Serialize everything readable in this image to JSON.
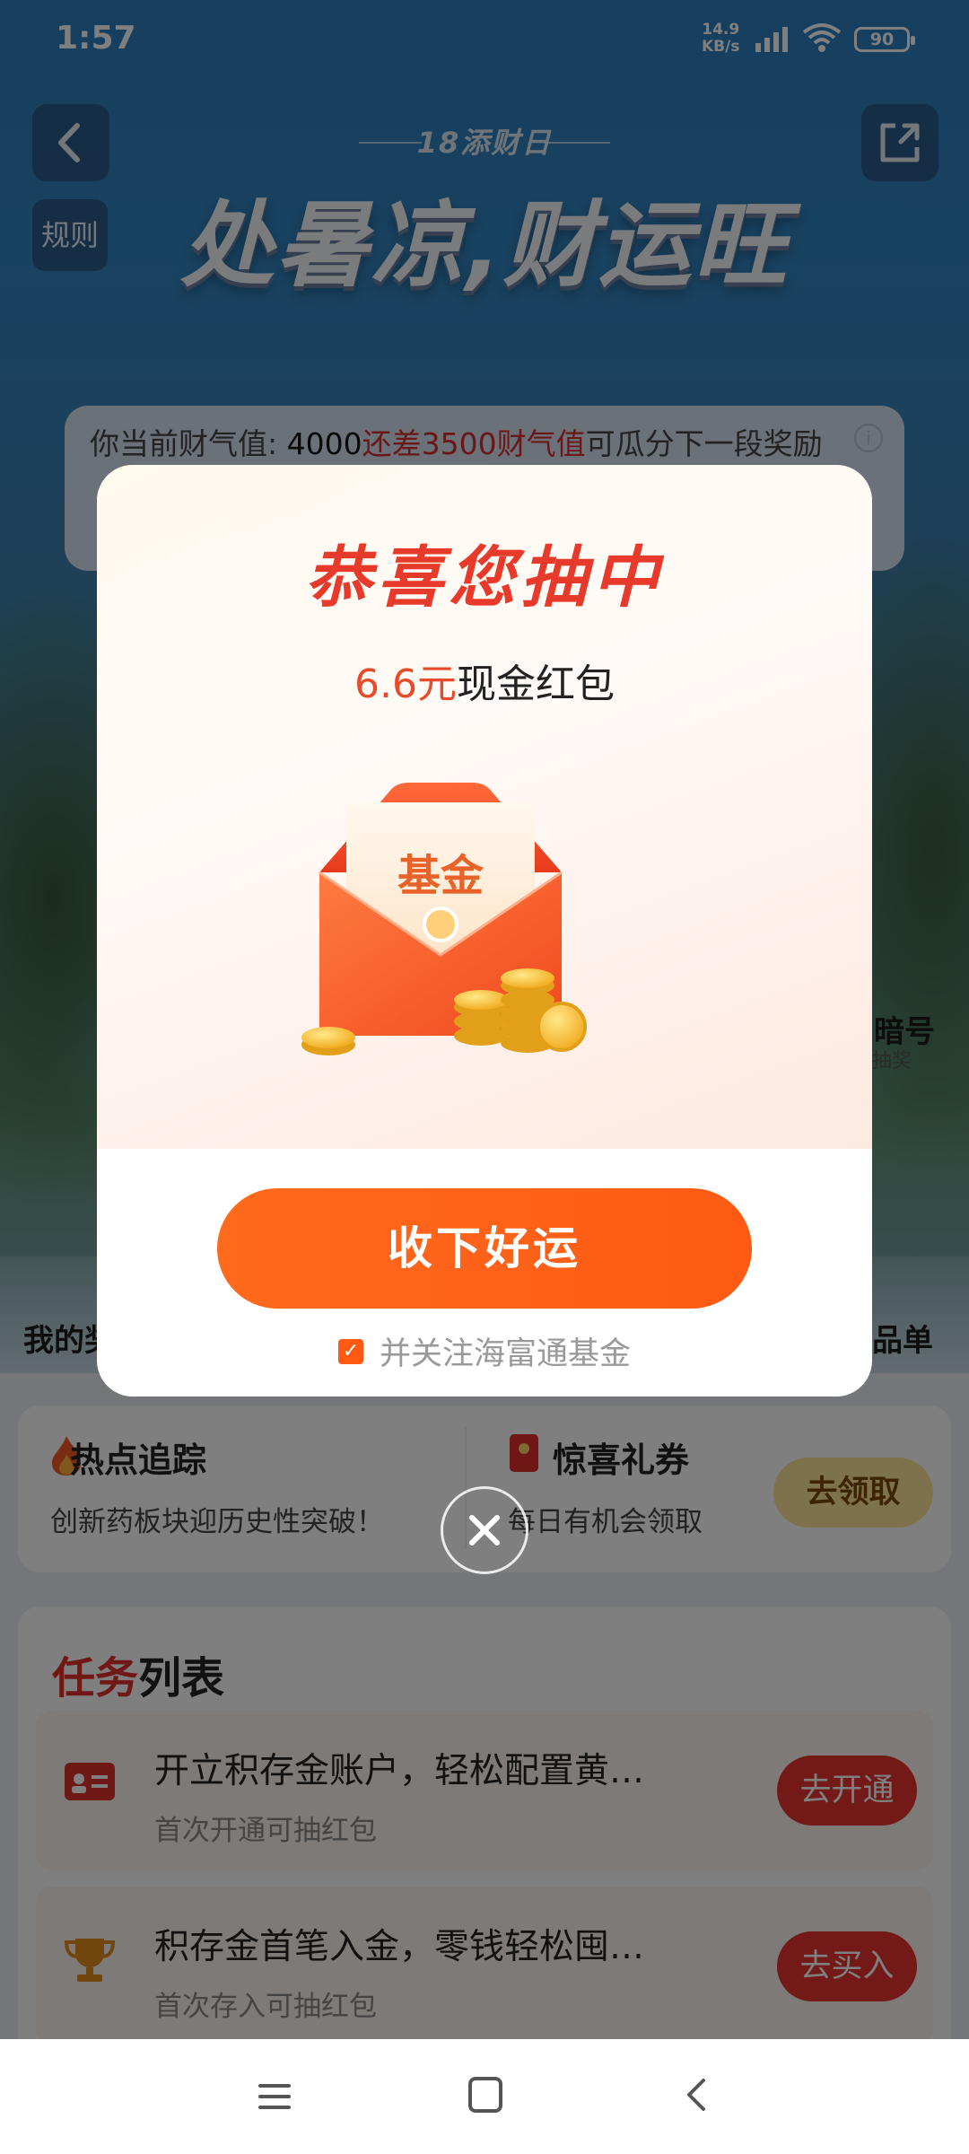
{
  "status_bar": {
    "time": "1:57",
    "net_speed_value": "14.9",
    "net_speed_unit": "KB/s",
    "battery": "90"
  },
  "page": {
    "rule_label": "规则",
    "banner_subtitle": "18添财日",
    "banner_title": "处暑凉,财运旺",
    "wealth": {
      "prefix": "你当前财气值: ",
      "current": "4000",
      "gap_text": "还差3500财气值",
      "suffix": "可瓜分下一段奖励"
    },
    "side_left_label": "我的奖",
    "side_right_label": "暗号",
    "side_right_small": "抽奖",
    "side_right_label2": "品单",
    "hot": {
      "left_title": "热点追踪",
      "left_desc": "创新药板块迎历史性突破！",
      "right_title": "惊喜礼券",
      "right_desc": "每日有机会领取",
      "claim_button": "去领取"
    },
    "tasks": {
      "title_red": "任务",
      "title_rest": "列表",
      "items": [
        {
          "title": "开立积存金账户，轻松配置黄…",
          "subtitle": "首次开通可抽红包",
          "button": "去开通",
          "icon": "id-card-icon"
        },
        {
          "title": "积存金首笔入金，零钱轻松囤…",
          "subtitle": "首次存入可抽红包",
          "button": "去买入",
          "icon": "trophy-icon"
        }
      ]
    }
  },
  "dialog": {
    "title": "恭喜您抽中",
    "prize_amount": "6.6元",
    "prize_text": "现金红包",
    "envelope_label": "基金",
    "accept_button": "收下好运",
    "follow_text": "并关注海富通基金",
    "follow_checked": true
  },
  "colors": {
    "accent_orange": "#fe5a14",
    "title_red": "#e83a2a",
    "task_button_red": "#e6332e"
  }
}
